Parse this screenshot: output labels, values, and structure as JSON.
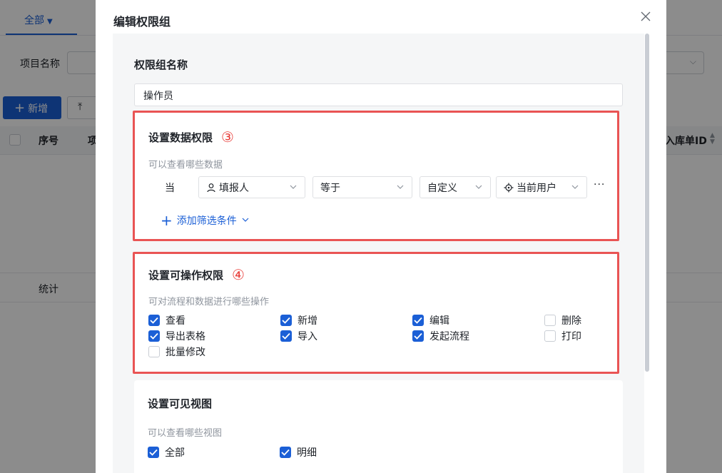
{
  "background": {
    "tab_label": "全部",
    "filter_label": "项目名称",
    "add_button": "新增",
    "table_headers": [
      "序号",
      "项",
      "入库单ID"
    ],
    "stat_label": "统计"
  },
  "dialog": {
    "title": "编辑权限组",
    "name_section": {
      "title": "权限组名称",
      "value": "操作员"
    },
    "data_section": {
      "title": "设置数据权限",
      "marker": "③",
      "subtitle": "可以查看哪些数据",
      "condition": {
        "when": "当",
        "field": "填报人",
        "operator": "等于",
        "value_type": "自定义",
        "value": "当前用户",
        "more": "···"
      },
      "add_filter": "添加筛选条件"
    },
    "operation_section": {
      "title": "设置可操作权限",
      "marker": "④",
      "subtitle": "可对流程和数据进行哪些操作",
      "options": [
        {
          "label": "查看",
          "checked": true
        },
        {
          "label": "新增",
          "checked": true
        },
        {
          "label": "编辑",
          "checked": true
        },
        {
          "label": "删除",
          "checked": false
        },
        {
          "label": "导出表格",
          "checked": true
        },
        {
          "label": "导入",
          "checked": true
        },
        {
          "label": "发起流程",
          "checked": true
        },
        {
          "label": "打印",
          "checked": false
        },
        {
          "label": "批量修改",
          "checked": false
        }
      ]
    },
    "view_section": {
      "title": "设置可见视图",
      "subtitle": "可以查看哪些视图",
      "options": [
        {
          "label": "全部",
          "checked": true
        },
        {
          "label": "明细",
          "checked": true
        }
      ]
    }
  },
  "colors": {
    "primary": "#1b5fd6",
    "highlight_border": "#e95454",
    "marker": "#e8403c"
  }
}
